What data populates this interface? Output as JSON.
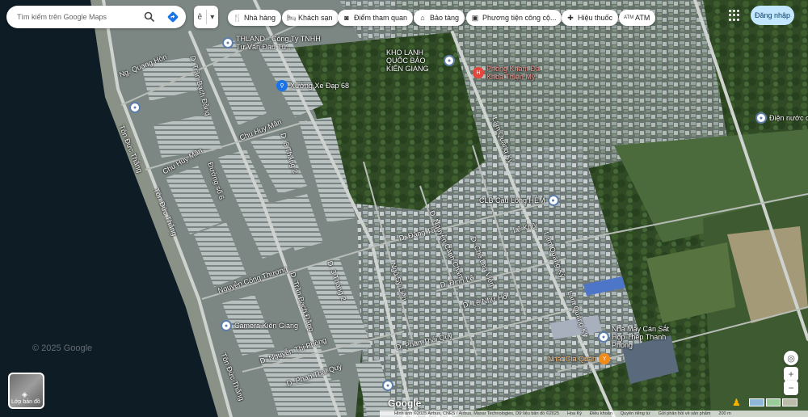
{
  "search": {
    "placeholder": "Tìm kiếm trên Google Maps"
  },
  "layers_toggle": {
    "label": "ê"
  },
  "chips": [
    {
      "icon": "restaurant-icon",
      "label": "Nhà hàng"
    },
    {
      "icon": "hotel-icon",
      "label": "Khách sạn"
    },
    {
      "icon": "camera-icon",
      "label": "Điểm tham quan"
    },
    {
      "icon": "museum-icon",
      "label": "Bảo tàng"
    },
    {
      "icon": "transit-icon",
      "label": "Phương tiện công cộ..."
    },
    {
      "icon": "pharmacy-icon",
      "label": "Hiệu thuốc"
    },
    {
      "icon": "atm-icon",
      "label": "ATM"
    }
  ],
  "signin_label": "Đăng nhập",
  "layer_box_label": "Lớp bản đồ",
  "google_logo": "Google",
  "watermark": "© 2025 Google",
  "attribution": [
    "Hình ảnh ©2025 Airbus, CNES / Airbus, Maxar Technologies, Dữ liệu bản đồ ©2025",
    "Hoa Kỳ",
    "Điều khoản",
    "Quyền riêng tư",
    "Gửi phản hồi về sản phẩm",
    "200 m"
  ],
  "roads": [
    "Ng. Quang Hòn",
    "Tôn Đức Thắng",
    "Chu Huy Mân",
    "D. Trần Bạch Đằng",
    "Chu Huy Mân",
    "Đường số 6",
    "Tôn Đức Thắng",
    "D. 3 Tháng 2",
    "D. 3 Tháng 2",
    "Nguyễn Công Thượng",
    "D. Trần Bạch Đằng",
    "Tôn Đức Thắng",
    "D. Nguyễn Thị Phòng",
    "D. Phan Thái Quý",
    "D. Phan Thái Quý",
    "D. Đặng Tất",
    "D. Nguyễn Cảnh Chân",
    "D. Đinh Lễ",
    "D. Lê Như Hổ",
    "D. Chế Lan Viên",
    "Lê Khôi",
    "Ngô Sỹ Liên",
    "Lâm Quang Ky",
    "Lâm Quang Kỳ",
    "Lâm Quang Ky"
  ],
  "pois": [
    {
      "icon": "place-icon",
      "label": "THLAND - Công Ty TNHH Tư Vấn Đầu Tư..."
    },
    {
      "icon": "bike-shop-icon",
      "label": "Xưởng Xe Đạp 68"
    },
    {
      "icon": "place-icon",
      "label": "KHO LẠNH QUỐC BẢO KIÊN GIANG"
    },
    {
      "icon": "hospital-icon",
      "label": "Phòng Khám Đa Khoa Thiện Mỹ"
    },
    {
      "icon": "place-icon",
      "label": "CLB Cầu Lông HẺM"
    },
    {
      "icon": "place-icon",
      "label": "Điện nước ch..."
    },
    {
      "icon": "place-icon",
      "label": "Camera Kiên Giang"
    },
    {
      "icon": "place-icon",
      "label": "Nhà Máy Cán Sắt Hộp Thép Thanh Phong"
    },
    {
      "icon": "restaurant-icon",
      "label": "Nhất Gia Quán"
    }
  ],
  "colors": {
    "water": "#0e1c26",
    "chip_bg": "#ffffff",
    "signin_bg": "#c2e7ff",
    "accent_blue": "#1a73e8"
  }
}
